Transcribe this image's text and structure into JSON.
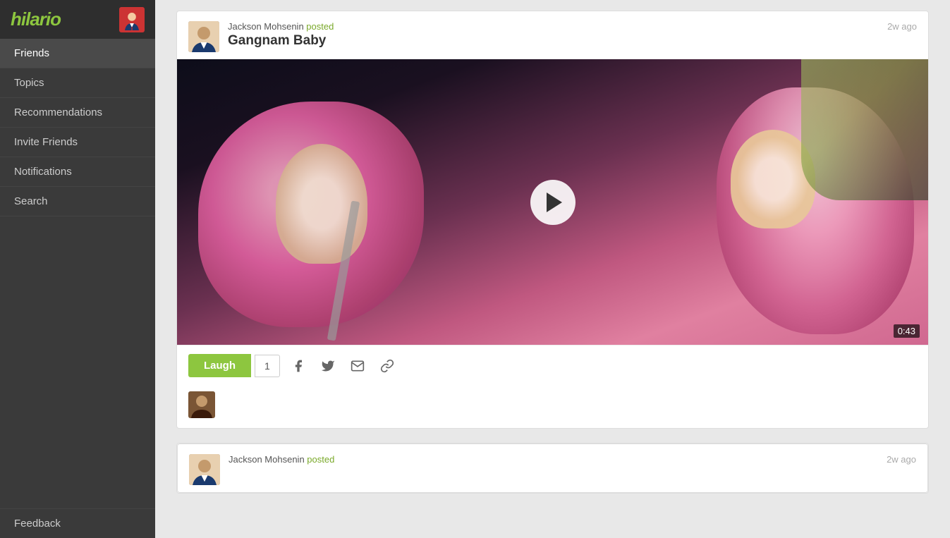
{
  "app": {
    "name": "hilario",
    "logo_color": "#8dc63f"
  },
  "sidebar": {
    "nav_items": [
      {
        "id": "friends",
        "label": "Friends",
        "active": true
      },
      {
        "id": "topics",
        "label": "Topics",
        "active": false
      },
      {
        "id": "recommendations",
        "label": "Recommendations",
        "active": false
      },
      {
        "id": "invite-friends",
        "label": "Invite Friends",
        "active": false
      },
      {
        "id": "notifications",
        "label": "Notifications",
        "active": false
      },
      {
        "id": "search",
        "label": "Search",
        "active": false
      }
    ],
    "feedback_label": "Feedback"
  },
  "posts": [
    {
      "id": "post-1",
      "poster_name": "Jackson Mohsenin",
      "posted_word": "posted",
      "time_ago": "2w ago",
      "title": "Gangnam Baby",
      "video_duration": "0:43",
      "laugh_count": "1",
      "laugh_label": "Laugh"
    },
    {
      "id": "post-2",
      "poster_name": "Jackson Mohsenin",
      "posted_word": "posted",
      "time_ago": "2w ago",
      "title": ""
    }
  ],
  "share_icons": {
    "facebook": "f",
    "twitter": "t",
    "email": "✉",
    "link": "⚙"
  }
}
